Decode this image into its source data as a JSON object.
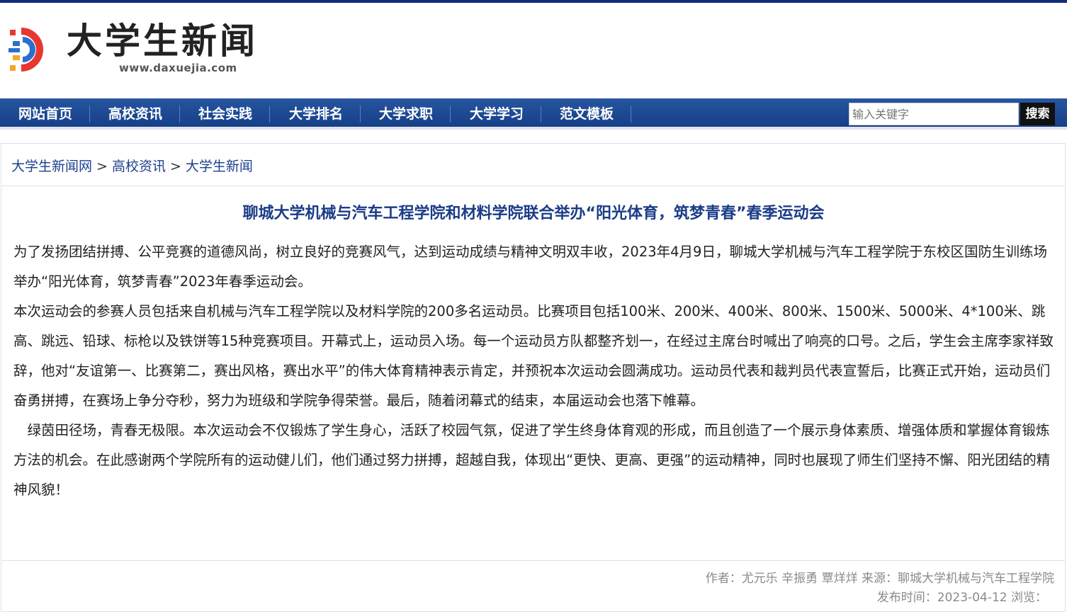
{
  "site": {
    "name": "大学生新闻",
    "url": "www.daxuejia.com",
    "brand_color": "#0f2f7d",
    "logo_colors": [
      "#e8372f",
      "#2a6fd0",
      "#f5a623"
    ]
  },
  "nav": {
    "items": [
      "网站首页",
      "高校资讯",
      "社会实践",
      "大学排名",
      "大学求职",
      "大学学习",
      "范文模板"
    ],
    "search_placeholder": "输入关键字",
    "search_button": "搜索"
  },
  "breadcrumb": [
    "大学生新闻网",
    "高校资讯",
    "大学生新闻"
  ],
  "breadcrumb_sep": ">",
  "article": {
    "title": "聊城大学机械与汽车工程学院和材料学院联合举办“阳光体育，筑梦青春”春季运动会",
    "paragraphs": [
      "为了发扬团结拼搏、公平竞赛的道德风尚，树立良好的竞赛风气，达到运动成绩与精神文明双丰收，2023年4月9日，聊城大学机械与汽车工程学院于东校区国防生训练场举办“阳光体育，筑梦青春”2023年春季运动会。",
      "本次运动会的参赛人员包括来自机械与汽车工程学院以及材料学院的200多名运动员。比赛项目包括100米、200米、400米、800米、1500米、5000米、4*100米、跳高、跳远、铅球、标枪以及铁饼等15种竞赛项目。开幕式上，运动员入场。每一个运动员方队都整齐划一，在经过主席台时喊出了响亮的口号。之后，学生会主席李家祥致辞，他对“友谊第一、比赛第二，赛出风格，赛出水平”的伟大体育精神表示肯定，并预祝本次运动会圆满成功。运动员代表和裁判员代表宣誓后，比赛正式开始，运动员们奋勇拼搏，在赛场上争分夺秒，努力为班级和学院争得荣誉。最后，随着闭幕式的结束，本届运动会也落下帷幕。",
      "　绿茵田径场，青春无极限。本次运动会不仅锻炼了学生身心，活跃了校园气氛，促进了学生终身体育观的形成，而且创造了一个展示身体素质、增强体质和掌握体育锻炼方法的机会。在此感谢两个学院所有的运动健儿们，他们通过努力拼搏，超越自我，体现出“更快、更高、更强”的运动精神，同时也展现了师生们坚持不懈、阳光团结的精神风貌！"
    ],
    "author_line": "作者：尤元乐 辛振勇 覃烊烊 来源：聊城大学机械与汽车工程学院",
    "publish_line": "发布时间：2023-04-12 浏览："
  }
}
